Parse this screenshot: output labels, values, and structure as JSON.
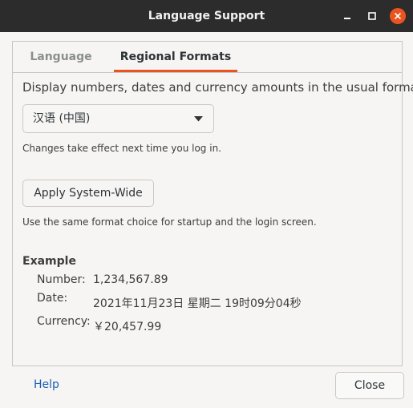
{
  "window": {
    "title": "Language Support",
    "controls": [
      "minimize-icon",
      "maximize-icon",
      "close-icon"
    ],
    "accent_color": "#e95420",
    "titlebar_color": "#2c2c2c"
  },
  "tabs": [
    {
      "label": "Language",
      "active": false
    },
    {
      "label": "Regional Formats",
      "active": true
    }
  ],
  "regional": {
    "description": "Display numbers, dates and currency amounts in the usual format for:",
    "format_select": {
      "selected": "汉语 (中国)"
    },
    "restart_note": "Changes take effect next time you log in.",
    "apply_button": "Apply System-Wide",
    "apply_note": "Use the same format choice for startup and the login screen."
  },
  "example": {
    "heading": "Example",
    "number_label": "Number:",
    "number_value": "1,234,567.89",
    "date_label": "Date:",
    "date_value": "2021年11月23日 星期二 19时09分04秒",
    "currency_label": "Currency:",
    "currency_value": "￥20,457.99"
  },
  "footer": {
    "help_label": "Help",
    "close_label": "Close",
    "link_color": "#1a5fb4"
  }
}
